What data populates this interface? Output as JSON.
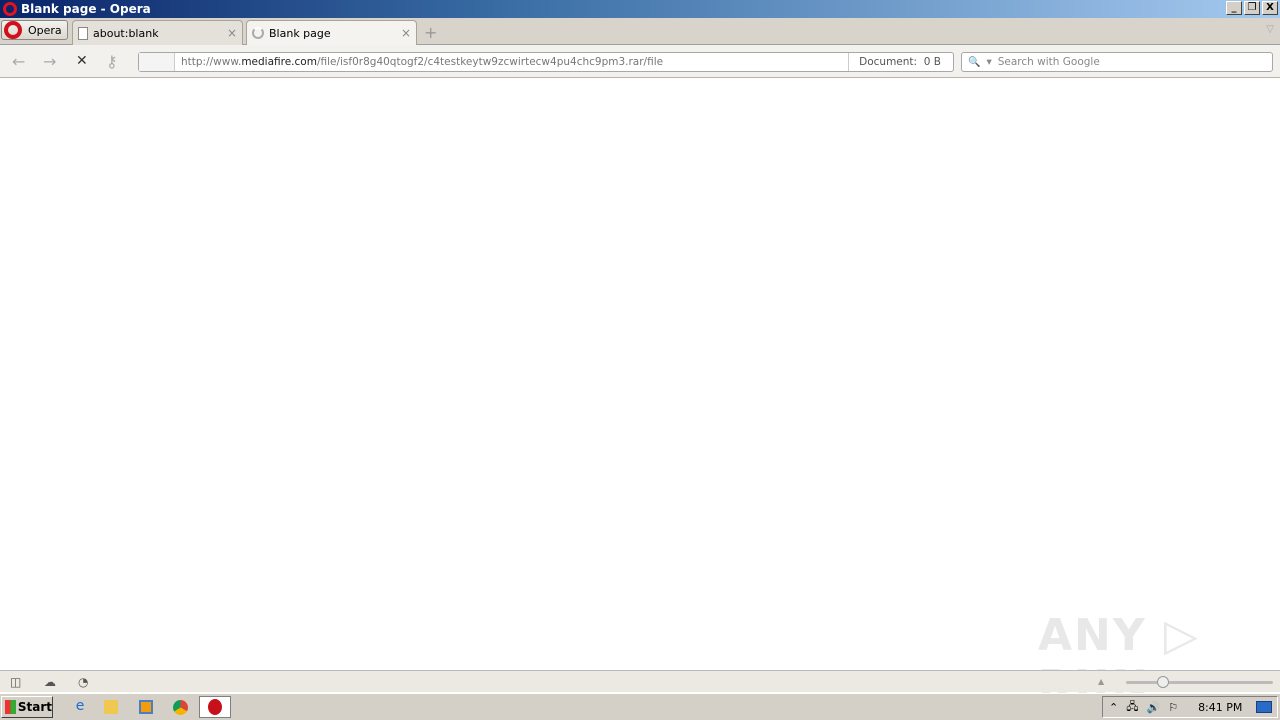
{
  "window": {
    "title": "Blank page - Opera",
    "minimize": "_",
    "restore": "❐",
    "close": "X"
  },
  "tabbar": {
    "menu_label": "Opera",
    "tabs": [
      {
        "label": "about:blank",
        "close": "×"
      },
      {
        "label": "Blank page",
        "close": "×"
      }
    ],
    "new_tab": "+",
    "tab_menu": "▽"
  },
  "toolbar": {
    "back": "←",
    "forward": "→",
    "stop": "✕",
    "key": "⚷",
    "url_prefix": "http://www.",
    "url_domain": "mediafire.com",
    "url_path": "/file/isf0r8g40qtogf2/c4testkeytw9zcwirtecw4pu4chc9pm3.rar/file",
    "doc_label": "Document:",
    "doc_size": "0 B",
    "search_placeholder": "Search with Google",
    "search_icon": "🔍",
    "search_dropdown": "▾"
  },
  "watermark": "ANY ▷ RUN",
  "statusbar": {
    "panel": "◫",
    "cloud": "☁",
    "speed": "◔",
    "zoom_arrow": "▲",
    "zoom_level": 0.25
  },
  "taskbar": {
    "start_label": "Start",
    "apps": [
      "ie-icon",
      "explorer-icon",
      "media-player-icon",
      "chrome-icon",
      "opera-icon"
    ],
    "tray": {
      "expand": "⌃",
      "network": "🖧",
      "volume": "🔊",
      "flag": "⚐",
      "time": "8:41 PM"
    }
  }
}
